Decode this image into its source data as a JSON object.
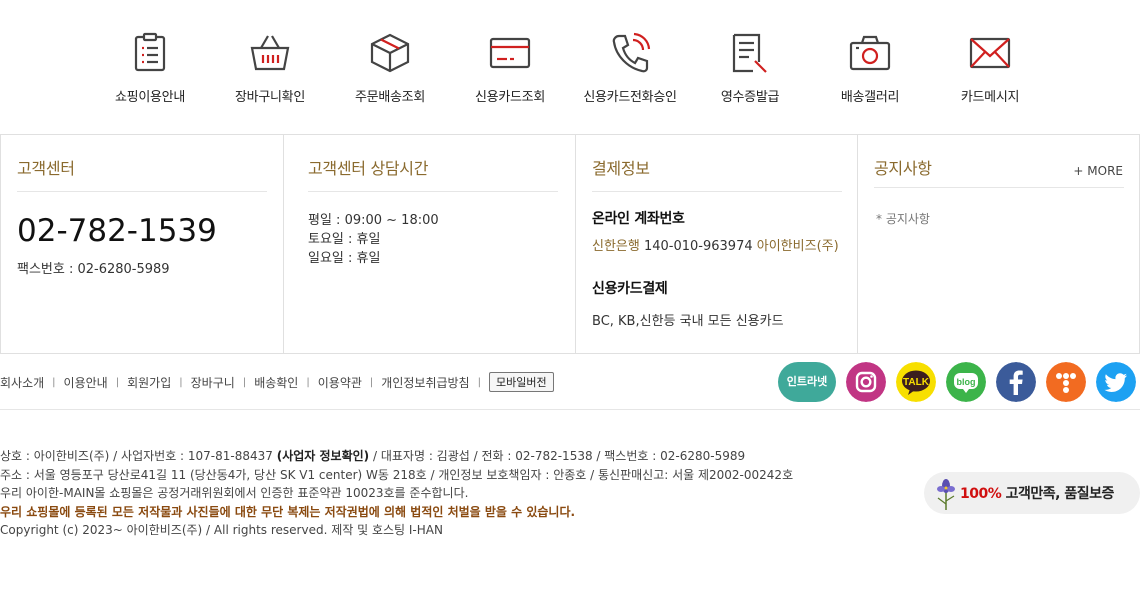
{
  "shortcuts": [
    {
      "label": "쇼핑이용안내",
      "icon": "clipboard-icon"
    },
    {
      "label": "장바구니확인",
      "icon": "basket-icon"
    },
    {
      "label": "주문배송조회",
      "icon": "box-icon"
    },
    {
      "label": "신용카드조회",
      "icon": "credit-card-icon"
    },
    {
      "label": "신용카드전화승인",
      "icon": "phone-icon"
    },
    {
      "label": "영수증발급",
      "icon": "receipt-icon"
    },
    {
      "label": "배송갤러리",
      "icon": "camera-icon"
    },
    {
      "label": "카드메시지",
      "icon": "envelope-icon"
    }
  ],
  "customer_center": {
    "title": "고객센터",
    "phone": "02-782-1539",
    "fax": "팩스번호 : 02-6280-5989"
  },
  "hours": {
    "title": "고객센터 상담시간",
    "lines": [
      "평일 : 09:00 ~ 18:00",
      "토요일 : 휴일",
      "일요일 : 휴일"
    ]
  },
  "payment": {
    "title": "결제정보",
    "account_title": "온라인 계좌번호",
    "bank": "신한은행",
    "account_number": "140-010-963974",
    "holder": "아이한비즈(주)",
    "card_title": "신용카드결제",
    "cards": "BC, KB,신한등 국내 모든 신용카드"
  },
  "notice": {
    "title": "공지사항",
    "more": "+ MORE",
    "items": [
      "* 공지사항"
    ]
  },
  "footer_nav": {
    "links": [
      "회사소개",
      "이용안내",
      "회원가입",
      "장바구니",
      "배송확인",
      "이용약관",
      "개인정보취급방침"
    ],
    "separator": "|",
    "mobile_button": "모바일버전"
  },
  "social": {
    "intranet_label": "인트라넷",
    "icons": [
      "instagram-icon",
      "kakaotalk-icon",
      "blog-icon",
      "facebook-icon",
      "tstory-icon",
      "twitter-icon"
    ],
    "talk_label": "TALK",
    "blog_label": "blog"
  },
  "company_info": {
    "line1_a": "상호 : 아이한비즈(주) / 사업자번호 : 107-81-88437 ",
    "line1_b": "(사업자 정보확인)",
    "line1_c": " / 대표자명 : 김광섭 / 전화 : 02-782-1538 / 팩스번호 : 02-6280-5989",
    "line2": "주소 : 서울 영등포구 당산로41길 11 (당산동4가, 당산 SK V1 center) W동 218호 / 개인정보 보호책임자 : 안종호 / 통신판매신고: 서울 제2002-00242호",
    "line3": "우리 아이한-MAIN몰 쇼핑몰은 공정거래위원회에서 인증한 표준약관 10023호를 준수합니다.",
    "line4": "우리 쇼핑몰에 등록된 모든 저작물과 사진들에 대한 무단 복제는 저작권법에 의해 법적인 처벌을 받을 수 있습니다.",
    "line5": "Copyright (c) 2023~ 아이한비즈(주) / All rights reserved. 제작 및 호스팅 I-HAN"
  },
  "badge": {
    "percent": "100%",
    "text": " 고객만족, 품질보증"
  },
  "colors": {
    "accent_gold": "#8a6a2e",
    "icon_dark": "#444444",
    "icon_red": "#d0201f"
  }
}
